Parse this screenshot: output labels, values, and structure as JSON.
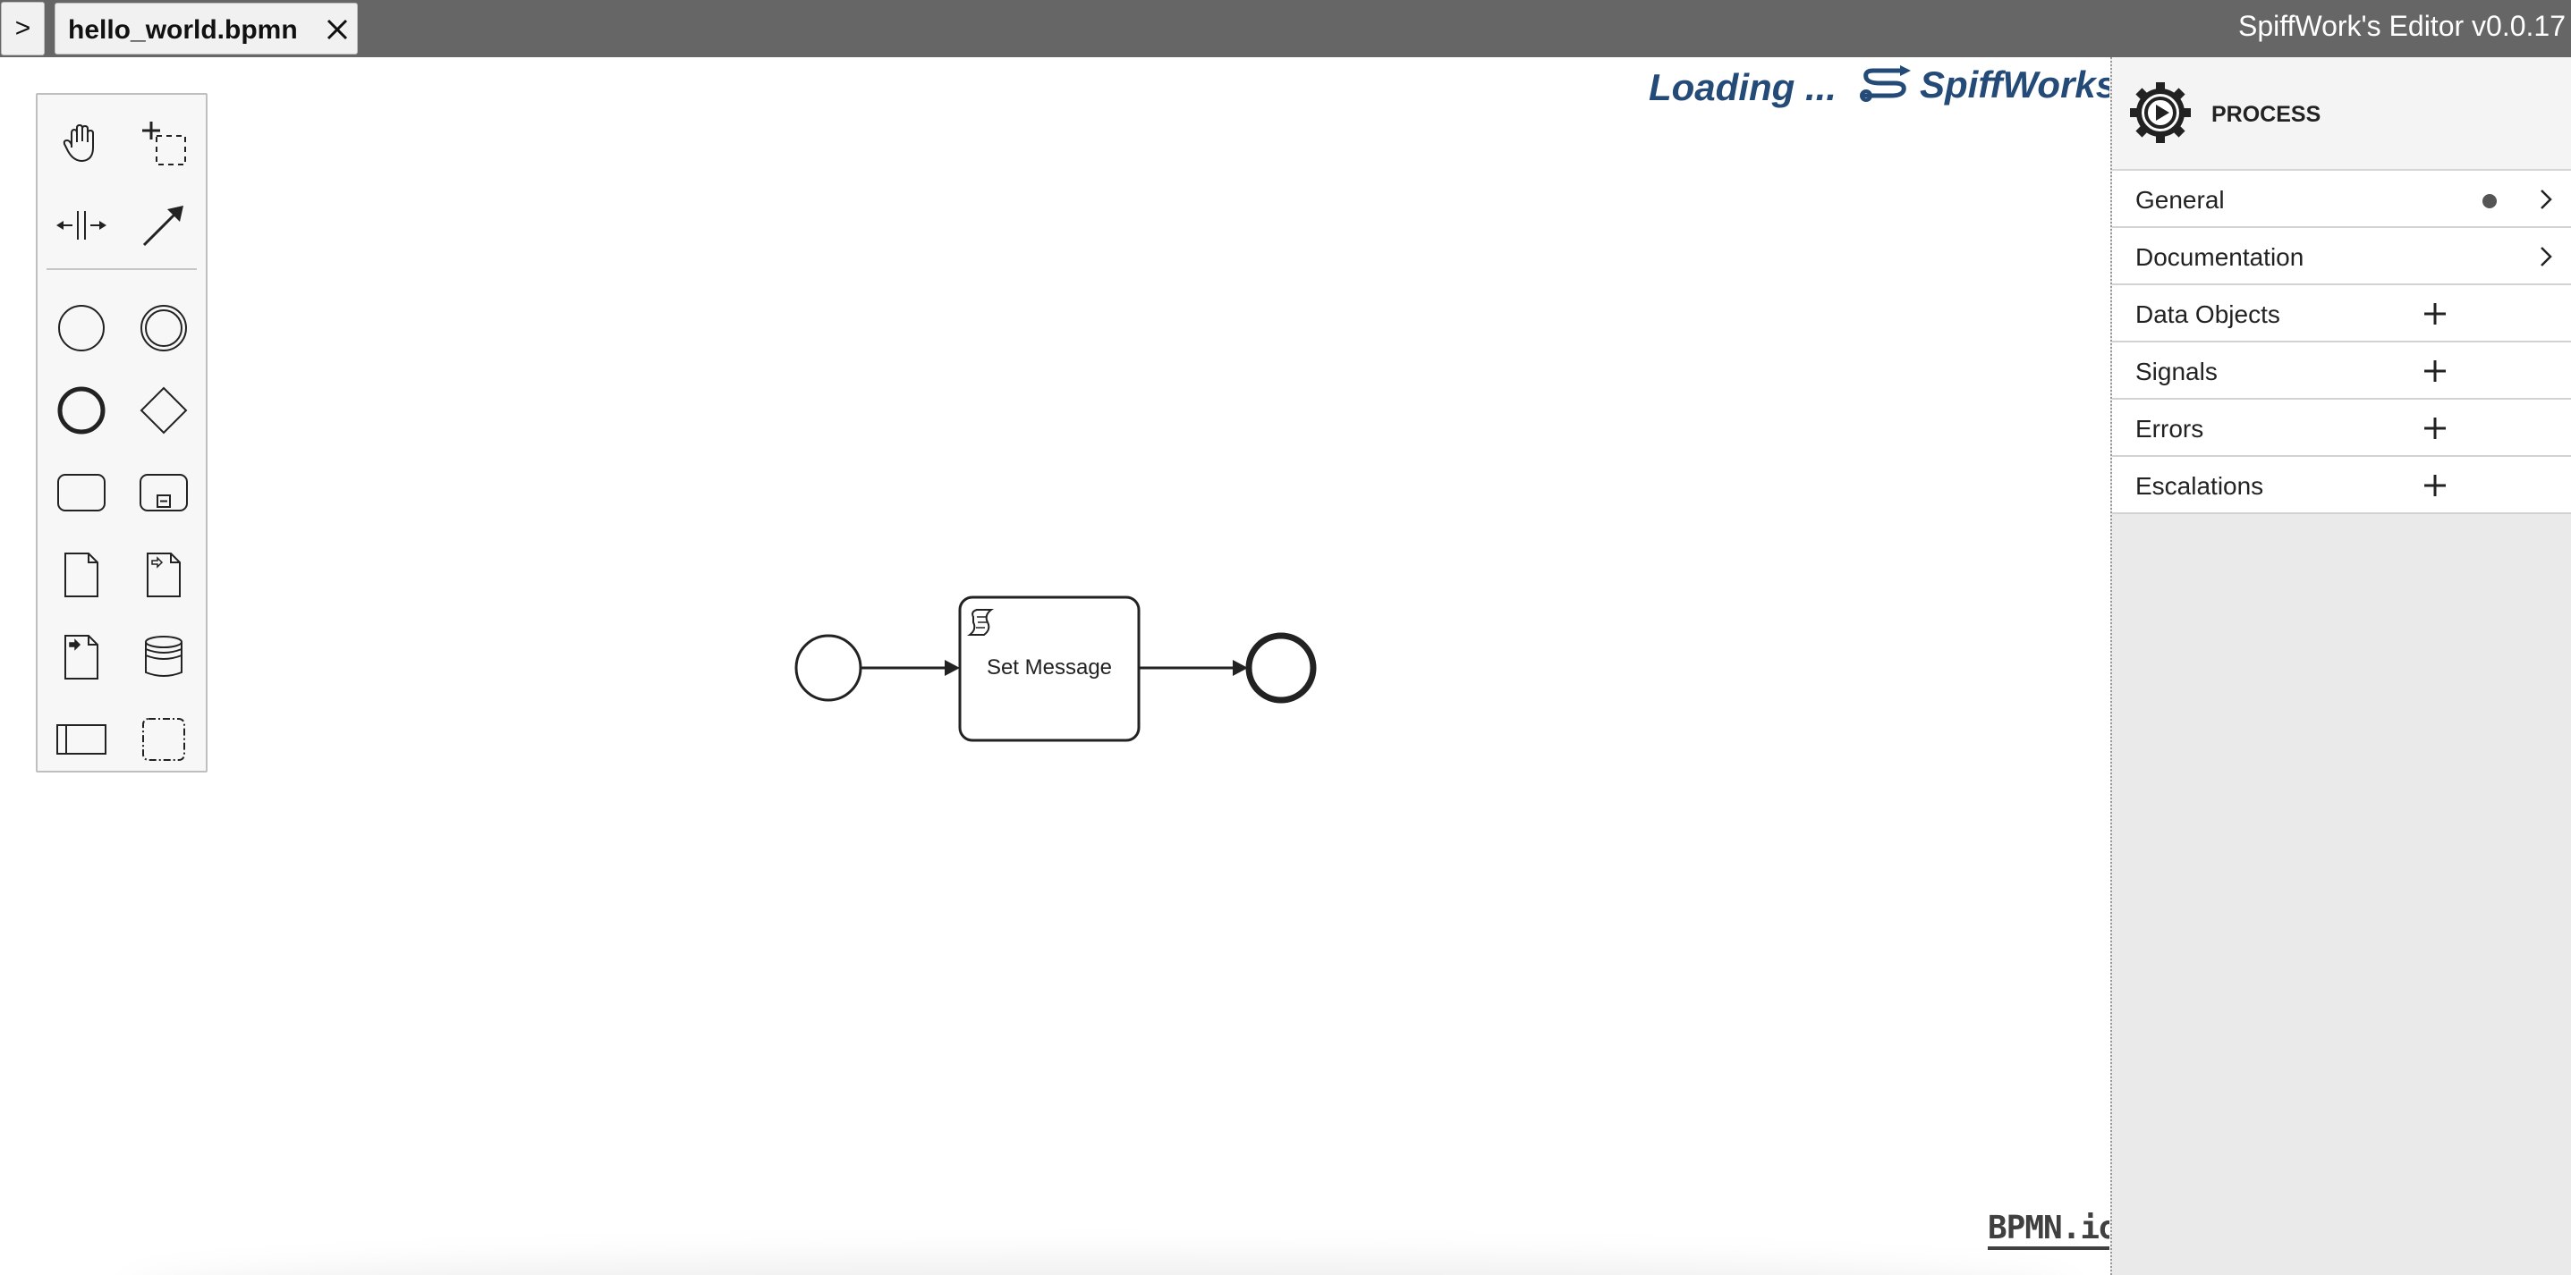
{
  "topbar": {
    "toggle_label": ">",
    "tab_name": "hello_world.bpmn",
    "app_title": "SpiffWork's Editor v0.0.17"
  },
  "canvas": {
    "loading_text": "Loading ...",
    "brand_name": "SpiffWorks",
    "task_label": "Set Message",
    "watermark": "BPMN.io"
  },
  "palette": {
    "tools": [
      "hand-tool-icon",
      "lasso-tool-icon",
      "space-tool-icon",
      "global-connect-icon",
      "start-event-icon",
      "intermediate-event-icon",
      "end-event-icon",
      "gateway-icon",
      "task-icon",
      "subprocess-icon",
      "data-object-icon",
      "data-input-icon",
      "data-output-icon",
      "data-store-icon",
      "participant-icon",
      "group-icon"
    ]
  },
  "panel": {
    "title": "PROCESS",
    "groups": [
      {
        "label": "General",
        "has_dot": true,
        "action": "chevron"
      },
      {
        "label": "Documentation",
        "has_dot": false,
        "action": "chevron"
      },
      {
        "label": "Data Objects",
        "has_dot": false,
        "action": "add"
      },
      {
        "label": "Signals",
        "has_dot": false,
        "action": "add"
      },
      {
        "label": "Errors",
        "has_dot": false,
        "action": "add"
      },
      {
        "label": "Escalations",
        "has_dot": false,
        "action": "add"
      }
    ]
  },
  "colors": {
    "topbar": "#666666",
    "brand": "#244a78",
    "panel_bg": "#eaeaea"
  }
}
